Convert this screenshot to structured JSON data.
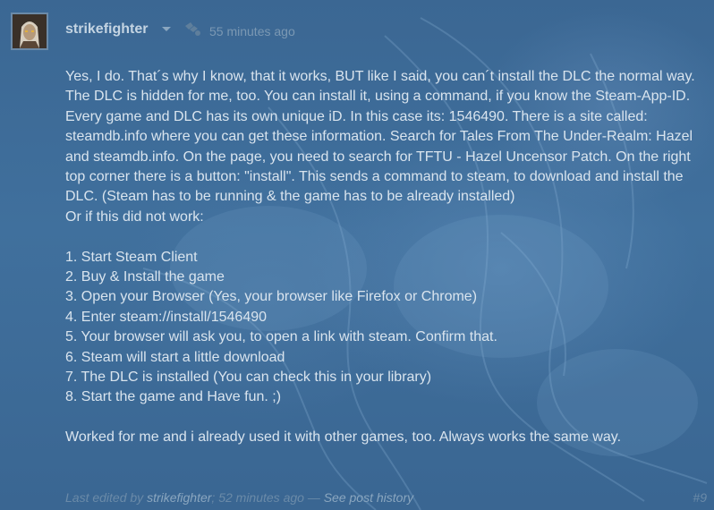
{
  "post": {
    "author": "strikefighter",
    "timestamp": "55 minutes ago",
    "badge_icon": "award-icon",
    "paragraph1": "Yes, I do. That´s why I know, that it works, BUT like I said, you can´t install the DLC the normal way. The DLC is hidden for me, too. You can install it, using a command, if you know the Steam-App-ID. Every game and DLC has its own unique iD. In this case its: 1546490. There is a site called: steamdb.info where you can get these information. Search for Tales From The Under-Realm: Hazel and steamdb.info. On the page, you need to search for TFTU - Hazel Uncensor Patch. On the right top corner there is a button: \"install\". This sends a command to steam, to download and install the DLC. (Steam has to be running & the game has to be already installed)",
    "paragraph2": "Or if this did not work:",
    "steps": [
      "1. Start Steam Client",
      "2. Buy & Install the game",
      "3. Open your Browser (Yes, your browser like Firefox or Chrome)",
      "4. Enter steam://install/1546490",
      "5. Your browser will ask you, to open a link with steam. Confirm that.",
      "6. Steam will start a little download",
      "7. The DLC is installed (You can check this in your library)",
      "8. Start the game and Have fun. ;)"
    ],
    "closing": "Worked for me and i already used it with other games, too. Always works the same way.",
    "edited": {
      "prefix": "Last edited by",
      "name": "strikefighter",
      "time": "; 52 minutes ago",
      "separator": "—",
      "history_link": "See post history"
    },
    "post_number": "#9"
  },
  "colors": {
    "background": "#3d6a96",
    "text": "#d9e4ee",
    "author": "#c4d4e2",
    "muted": "#7b98b3"
  }
}
